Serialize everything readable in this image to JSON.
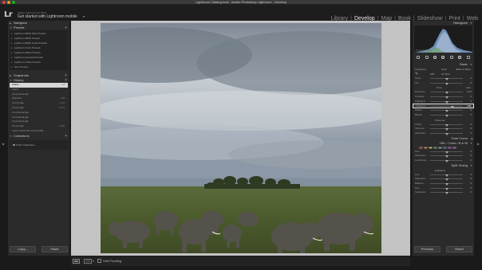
{
  "window": {
    "title": "Lightroom Catalog.lrcat - Adobe Photoshop Lightroom - Develop"
  },
  "identity": {
    "small_text": "Adobe Lightroom CC 2015",
    "main_text": "Get started with Lightroom mobile",
    "caret": "▾",
    "logo": "Lr"
  },
  "modules": [
    {
      "label": "Library",
      "active": false
    },
    {
      "label": "Develop",
      "active": true
    },
    {
      "label": "Map",
      "active": false
    },
    {
      "label": "Book",
      "active": false
    },
    {
      "label": "Slideshow",
      "active": false
    },
    {
      "label": "Print",
      "active": false
    },
    {
      "label": "Web",
      "active": false
    }
  ],
  "left_panel": {
    "navigator_label": "Navigator",
    "presets_label": "Presets",
    "presets": [
      "Lightroom B&W Filter Presets",
      "Lightroom B&W Presets",
      "Lightroom B&W Toned Presets",
      "Lightroom Color Presets",
      "Lightroom Effect Presets",
      "Lightroom General Presets",
      "Lightroom Video Presets",
      "User Presets"
    ],
    "snapshots_label": "Snapshots",
    "history_label": "History",
    "history": [
      {
        "label": "Clarity",
        "value": "+7"
      },
      {
        "label": "Clarity",
        "value": ""
      },
      {
        "label": "Crop Rectangle",
        "value": ""
      },
      {
        "label": "Shadows",
        "value": "+38"
      },
      {
        "label": "Crop Angle",
        "value": "-1.41"
      },
      {
        "label": "Crop Angle",
        "value": "+1.07"
      },
      {
        "label": "Crop Rectangle",
        "value": ""
      },
      {
        "label": "Crop Rectangle",
        "value": ""
      },
      {
        "label": "Crop Rectangle",
        "value": ""
      },
      {
        "label": "Crop Angle",
        "value": "+1.60"
      },
      {
        "label": "Import (10/17/15 2:24:54 PM)",
        "value": ""
      }
    ],
    "collections_label": "Collections",
    "collection_item": "Smart Collections",
    "copy_button": "Copy...",
    "paste_button": "Paste"
  },
  "toolbar": {
    "soft_proofing": "Soft Proofing",
    "yy": "Y|Y"
  },
  "right_panel": {
    "histogram_label": "Histogram",
    "original_photo": "Original Photo",
    "basic_label": "Basic",
    "treatment_label": "Treatment:",
    "color_label": "Color",
    "bw_label": "Black & White",
    "wb_label": "WB:",
    "wb_value": "As Shot",
    "tone_label": "Tone",
    "tone_value": "Auto",
    "presence_label": "Presence",
    "sliders_basic": [
      {
        "label": "Temp",
        "value": "0",
        "pos": 0.5
      },
      {
        "label": "Tint",
        "value": "0",
        "pos": 0.5
      },
      {
        "label": "Exposure",
        "value": "0.00",
        "pos": 0.5
      },
      {
        "label": "Contrast",
        "value": "0",
        "pos": 0.5
      },
      {
        "label": "Highlights",
        "value": "0",
        "pos": 0.5
      },
      {
        "label": "Shadows",
        "value": "+38",
        "pos": 0.69,
        "selected": true
      },
      {
        "label": "Whites",
        "value": "0",
        "pos": 0.5
      },
      {
        "label": "Blacks",
        "value": "0",
        "pos": 0.5
      }
    ],
    "sliders_presence": [
      {
        "label": "Clarity",
        "value": "0",
        "pos": 0.5
      },
      {
        "label": "Vibrance",
        "value": "0",
        "pos": 0.5
      },
      {
        "label": "Saturation",
        "value": "0",
        "pos": 0.5
      }
    ],
    "tone_curve_label": "Tone Curve",
    "hsl_label": "HSL / Color / B & W",
    "hsl_colors": [
      "#d43c2c",
      "#e0822a",
      "#e0d030",
      "#48a838",
      "#38b8b8",
      "#3858d8",
      "#8838c8",
      "#c838a0"
    ],
    "sliders_hsl": [
      {
        "label": "Hue",
        "value": "0",
        "pos": 0.5
      },
      {
        "label": "Saturation",
        "value": "0",
        "pos": 0.5
      },
      {
        "label": "Luminance",
        "value": "0",
        "pos": 0.5
      }
    ],
    "split_toning_label": "Split Toning",
    "split_highlights_label": "Highlights",
    "split_shadows_label": "Shadows",
    "sliders_split": [
      {
        "label": "Hue",
        "value": "0",
        "pos": 0.5
      },
      {
        "label": "Saturation",
        "value": "0",
        "pos": 0.5
      },
      {
        "label": "Balance",
        "value": "0",
        "pos": 0.5
      },
      {
        "label": "Hue",
        "value": "0",
        "pos": 0.5
      },
      {
        "label": "Saturation",
        "value": "0",
        "pos": 0.5
      }
    ],
    "previous_button": "Previous",
    "reset_button": "Reset"
  }
}
